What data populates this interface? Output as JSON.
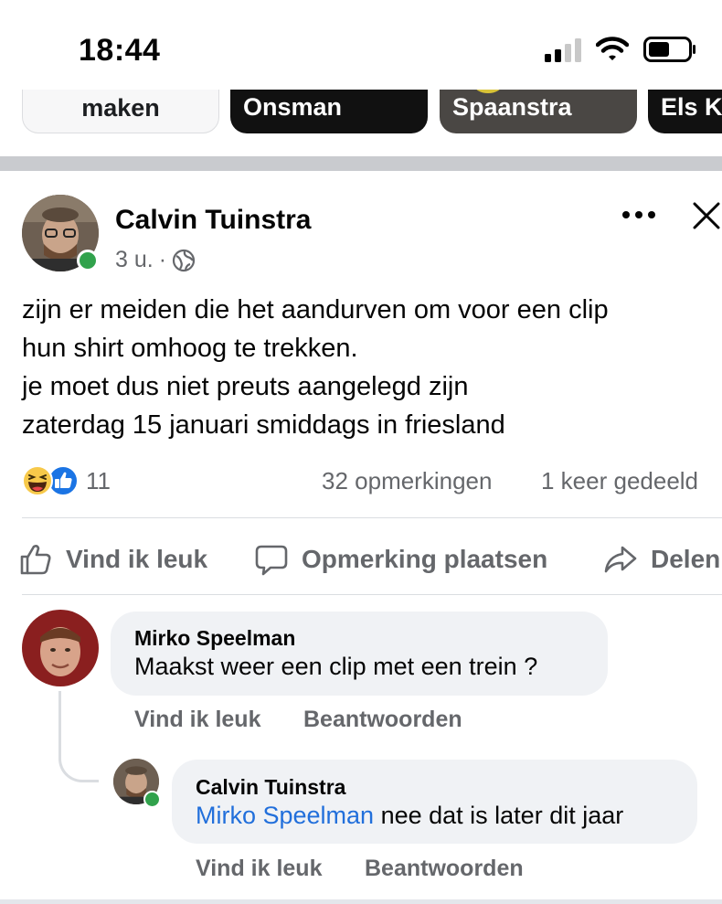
{
  "status_bar": {
    "time": "18:44",
    "icons": [
      "cellular-signal-icon",
      "wifi-icon",
      "battery-icon"
    ]
  },
  "stories": [
    {
      "label": "maken"
    },
    {
      "label": "Onsman"
    },
    {
      "label": "Spaanstra"
    },
    {
      "label": "Els Ki"
    }
  ],
  "post": {
    "author": "Calvin Tuinstra",
    "time": "3 u.",
    "separator": "·",
    "audience_icon": "globe-icon",
    "more_icon": "more-icon",
    "close_icon": "close-icon",
    "text_lines": [
      "zijn er meiden die het aandurven om voor een clip",
      "hun shirt omhoog te trekken.",
      "je moet dus niet preuts aangelegd zijn",
      "zaterdag 15 januari smiddags in friesland"
    ],
    "reactions": {
      "icons": [
        "haha-icon",
        "like-icon"
      ],
      "count": "11",
      "comments": "32 opmerkingen",
      "shares": "1 keer gedeeld"
    },
    "actions": {
      "like": "Vind ik leuk",
      "comment": "Opmerking plaatsen",
      "share": "Delen"
    }
  },
  "comments": [
    {
      "author": "Mirko Speelman",
      "text": "Maakst weer een clip met een trein ?",
      "like": "Vind ik leuk",
      "reply": "Beantwoorden"
    },
    {
      "author": "Calvin Tuinstra",
      "mention": "Mirko Speelman",
      "text": " nee dat is later dit jaar",
      "like": "Vind ik leuk",
      "reply": "Beantwoorden",
      "online": true
    }
  ],
  "colors": {
    "accent_blue": "#216fdb",
    "secondary_text": "#65676b",
    "bubble_bg": "#f0f2f5",
    "online_green": "#31a24c",
    "separator": "#c9cbcf"
  }
}
